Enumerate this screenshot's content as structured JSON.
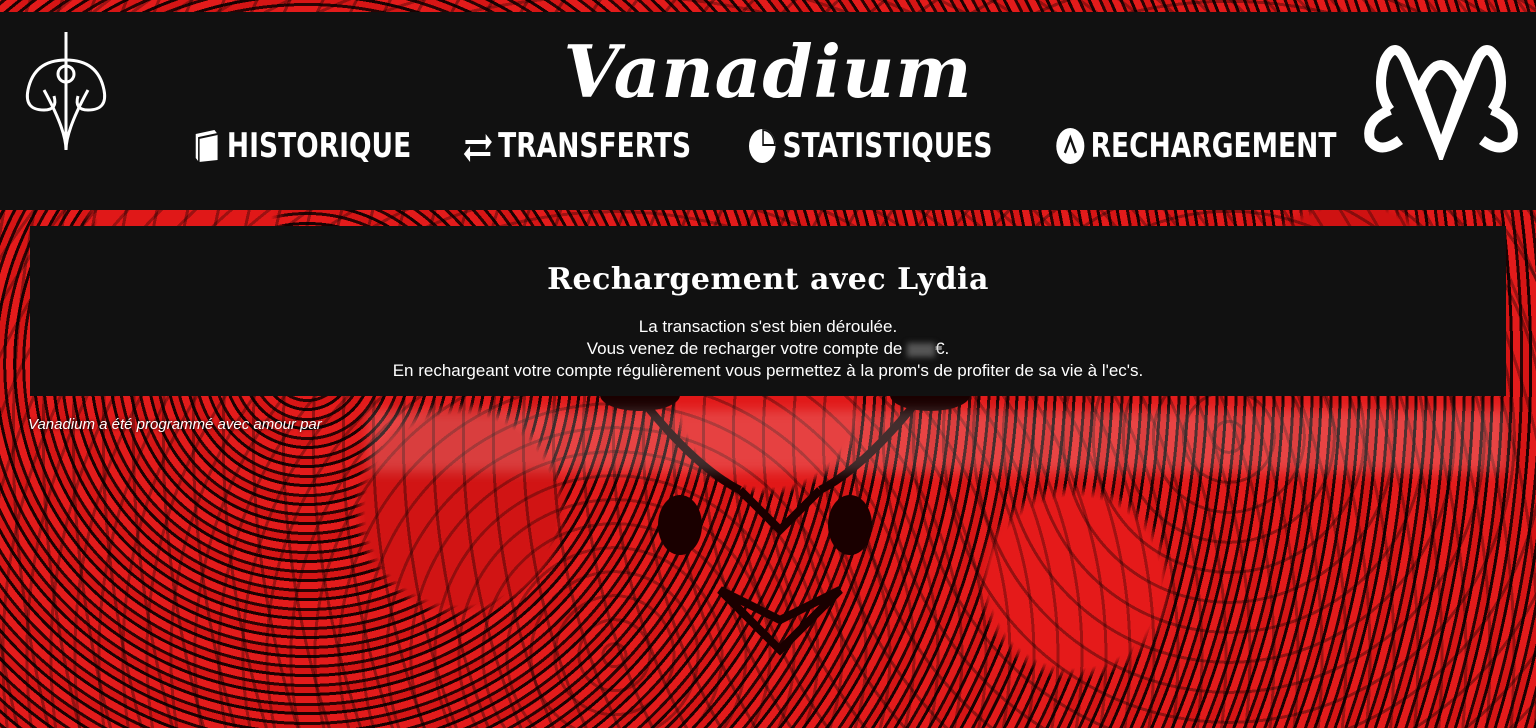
{
  "site": {
    "title": "Vanadium"
  },
  "nav": {
    "items": [
      {
        "label": "HISTORIQUE",
        "icon": "book-icon"
      },
      {
        "label": "TRANSFERTS",
        "icon": "exchange-icon"
      },
      {
        "label": "STATISTIQUES",
        "icon": "pie-chart-icon"
      },
      {
        "label": "RECHARGEMENT",
        "icon": "lydia-icon"
      }
    ]
  },
  "panel": {
    "title": "Rechargement avec Lydia",
    "line1": "La transaction s'est bien déroulée.",
    "line2_prefix": "Vous venez de recharger votre compte de ",
    "line2_suffix": "€.",
    "line3": "En rechargeant votre compte régulièrement vous permettez à la prom's de profiter de sa vie à l'ec's."
  },
  "footer": {
    "credit": "Vanadium a été programmé avec amour par"
  },
  "colors": {
    "background_red": "#d61515",
    "panel_bg": "#111111",
    "text": "#ffffff"
  }
}
